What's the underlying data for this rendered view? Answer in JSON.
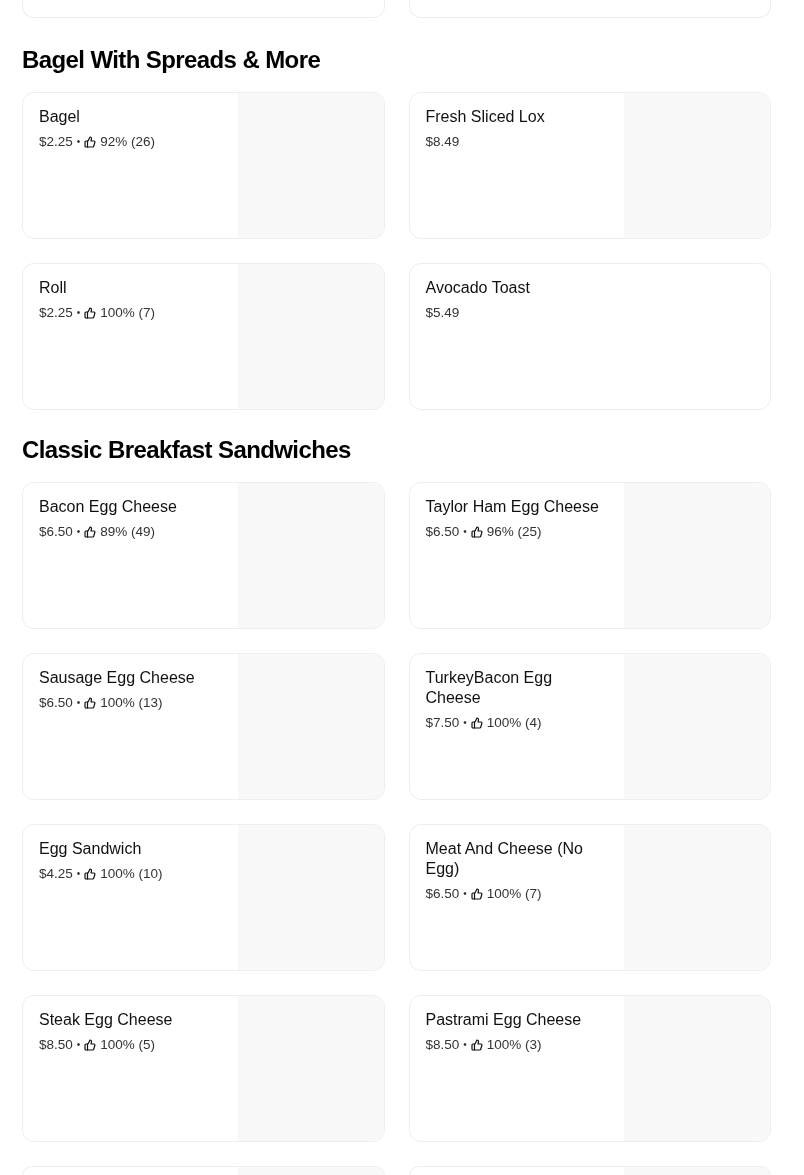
{
  "top_partial_cards": [
    {
      "has_image": false
    },
    {
      "has_image": false
    }
  ],
  "sections": [
    {
      "title": "Bagel With Spreads & More",
      "items": [
        {
          "name": "Bagel",
          "price": "$2.25",
          "separator": "•",
          "rating": "92% (26)",
          "has_image": true
        },
        {
          "name": "Fresh Sliced Lox",
          "price": "$8.49",
          "has_image": true
        },
        {
          "name": "Roll",
          "price": "$2.25",
          "separator": "•",
          "rating": "100% (7)",
          "has_image": true
        },
        {
          "name": "Avocado Toast",
          "price": "$5.49",
          "has_image": false
        }
      ]
    },
    {
      "title": "Classic Breakfast Sandwiches",
      "items": [
        {
          "name": "Bacon Egg Cheese",
          "price": "$6.50",
          "separator": "•",
          "rating": "89% (49)",
          "has_image": true
        },
        {
          "name": "Taylor Ham Egg Cheese",
          "price": "$6.50",
          "separator": "•",
          "rating": "96% (25)",
          "has_image": true
        },
        {
          "name": "Sausage Egg Cheese",
          "price": "$6.50",
          "separator": "•",
          "rating": "100% (13)",
          "has_image": true
        },
        {
          "name": "TurkeyBacon Egg Cheese",
          "price": "$7.50",
          "separator": "•",
          "rating": "100% (4)",
          "has_image": true
        },
        {
          "name": "Egg Sandwich",
          "price": "$4.25",
          "separator": "•",
          "rating": "100% (10)",
          "has_image": true
        },
        {
          "name": "Meat And Cheese (No Egg)",
          "price": "$6.50",
          "separator": "•",
          "rating": "100% (7)",
          "has_image": true
        },
        {
          "name": "Steak Egg Cheese",
          "price": "$8.50",
          "separator": "•",
          "rating": "100% (5)",
          "has_image": true
        },
        {
          "name": "Pastrami Egg Cheese",
          "price": "$8.50",
          "separator": "•",
          "rating": "100% (3)",
          "has_image": true
        }
      ]
    }
  ],
  "bottom_partial_cards": [
    {
      "has_image": true
    },
    {
      "has_image": true
    }
  ]
}
